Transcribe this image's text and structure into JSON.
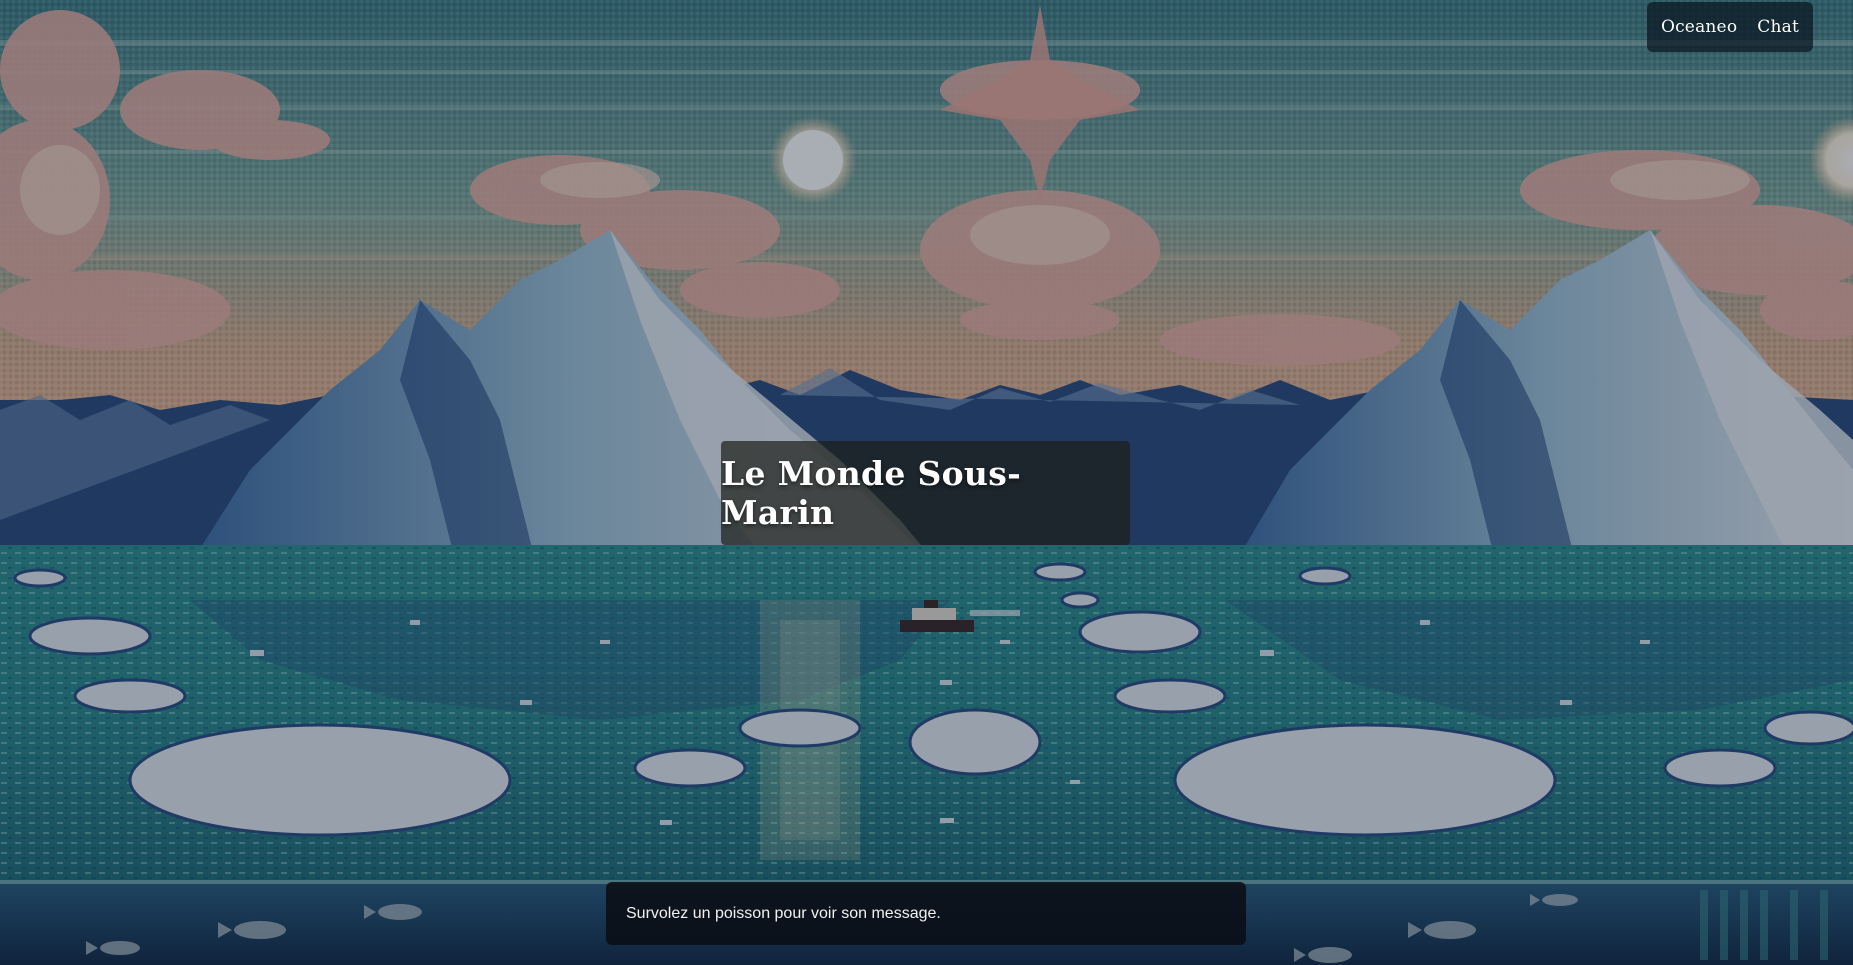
{
  "nav": {
    "links": [
      "Oceaneo",
      "Chat"
    ]
  },
  "hero": {
    "title": "Le Monde Sous-Marin"
  },
  "message_bar": {
    "text": "Survolez un poisson pour voir son message."
  },
  "background": {
    "description_icon": "arctic-seascape-image"
  },
  "colors": {
    "sky_top": "#4f8f94",
    "sky_mid": "#9bb6a2",
    "horizon": "#e2b38e",
    "water": "#2b8c8e",
    "ice": "#e9eef2",
    "ice_shadow": "#2b4f86",
    "deep_water": "#1a3550"
  }
}
